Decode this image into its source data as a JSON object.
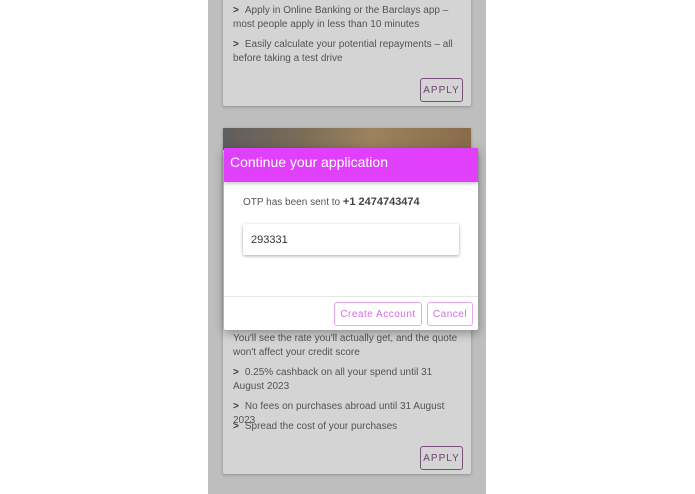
{
  "card1": {
    "bullets": [
      "Apply in Online Banking or the Barclays app – most people apply in less than 10 minutes",
      "Easily calculate your potential repayments – all before taking a test drive"
    ],
    "apply_label": "APPLY"
  },
  "card2": {
    "intro": "You'll see the rate you'll actually get, and the quote won't affect your credit score",
    "bullets": [
      "0.25% cashback on all your spend until 31 August 2023",
      "No fees on purchases abroad until 31 August 2023",
      "Spread the cost of your purchases"
    ],
    "apply_label": "APPLY"
  },
  "bullet_marker": ">",
  "dialog": {
    "title": "Continue your application",
    "otp_prefix": "OTP has been sent to",
    "phone": "+1 2474743474",
    "otp_value": "293331",
    "create_label": "Create Account",
    "cancel_label": "Cancel"
  },
  "colors": {
    "header": "#e040fb",
    "dialog_button_text": "#d66bea",
    "apply_border": "#8a5a8e"
  }
}
